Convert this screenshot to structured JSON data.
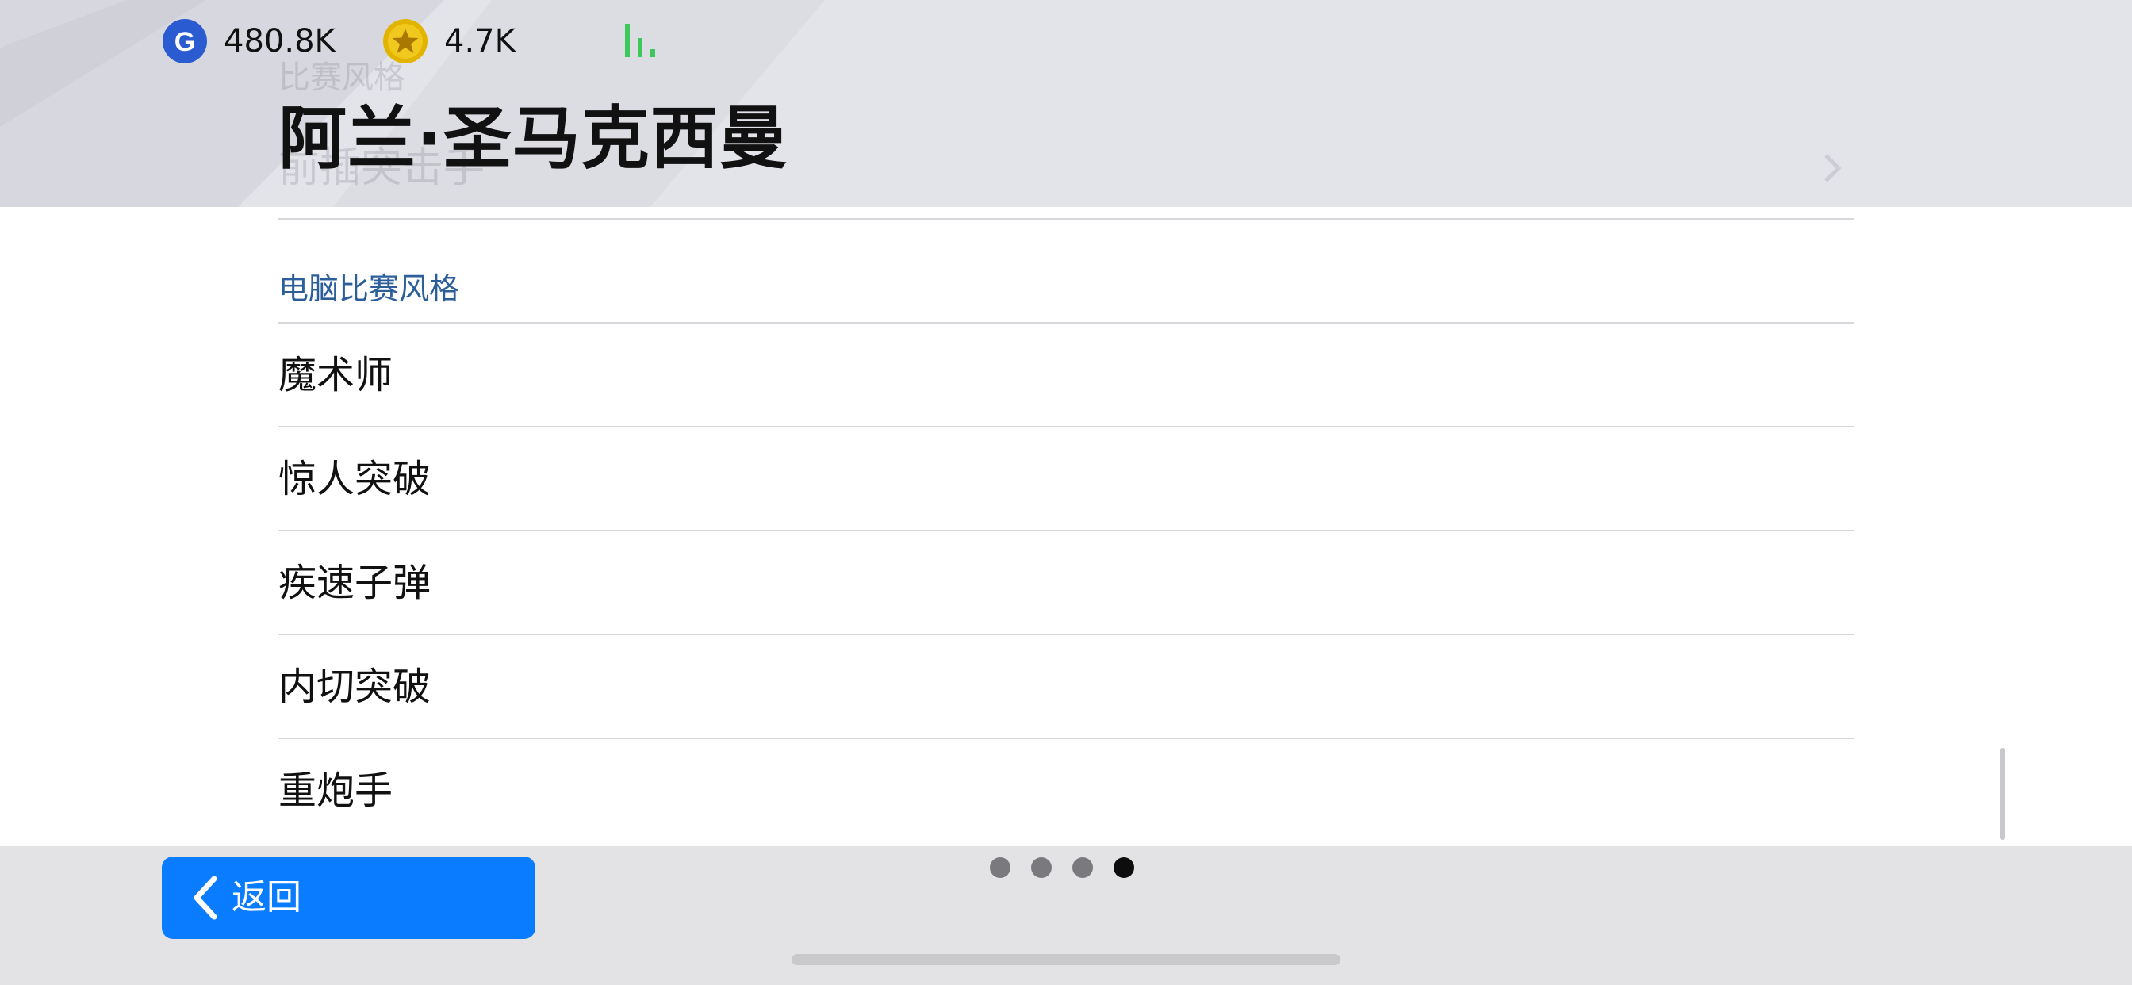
{
  "header": {
    "gp_value": "480.8K",
    "coin_value": "4.7K",
    "ghost_label": "比赛风格",
    "ghost_value": "前插突击手",
    "player_name": "阿兰·圣马克西曼"
  },
  "section": {
    "title": "电脑比赛风格",
    "items": [
      {
        "label": "魔术师"
      },
      {
        "label": "惊人突破"
      },
      {
        "label": "疾速子弹"
      },
      {
        "label": "内切突破"
      },
      {
        "label": "重炮手"
      }
    ]
  },
  "footer": {
    "back_label": "返回",
    "pages_total": 4,
    "current_page": 4
  },
  "colors": {
    "accent": "#0a7cff",
    "section_title": "#2c5f9a",
    "signal": "#3cc85a",
    "gp_icon": "#2a5bd0",
    "coin_icon": "#e2b400"
  },
  "icons": {
    "gp": "gp-currency-icon",
    "coin": "star-coin-icon",
    "signal": "signal-bars-icon",
    "back": "chevron-left-icon"
  }
}
